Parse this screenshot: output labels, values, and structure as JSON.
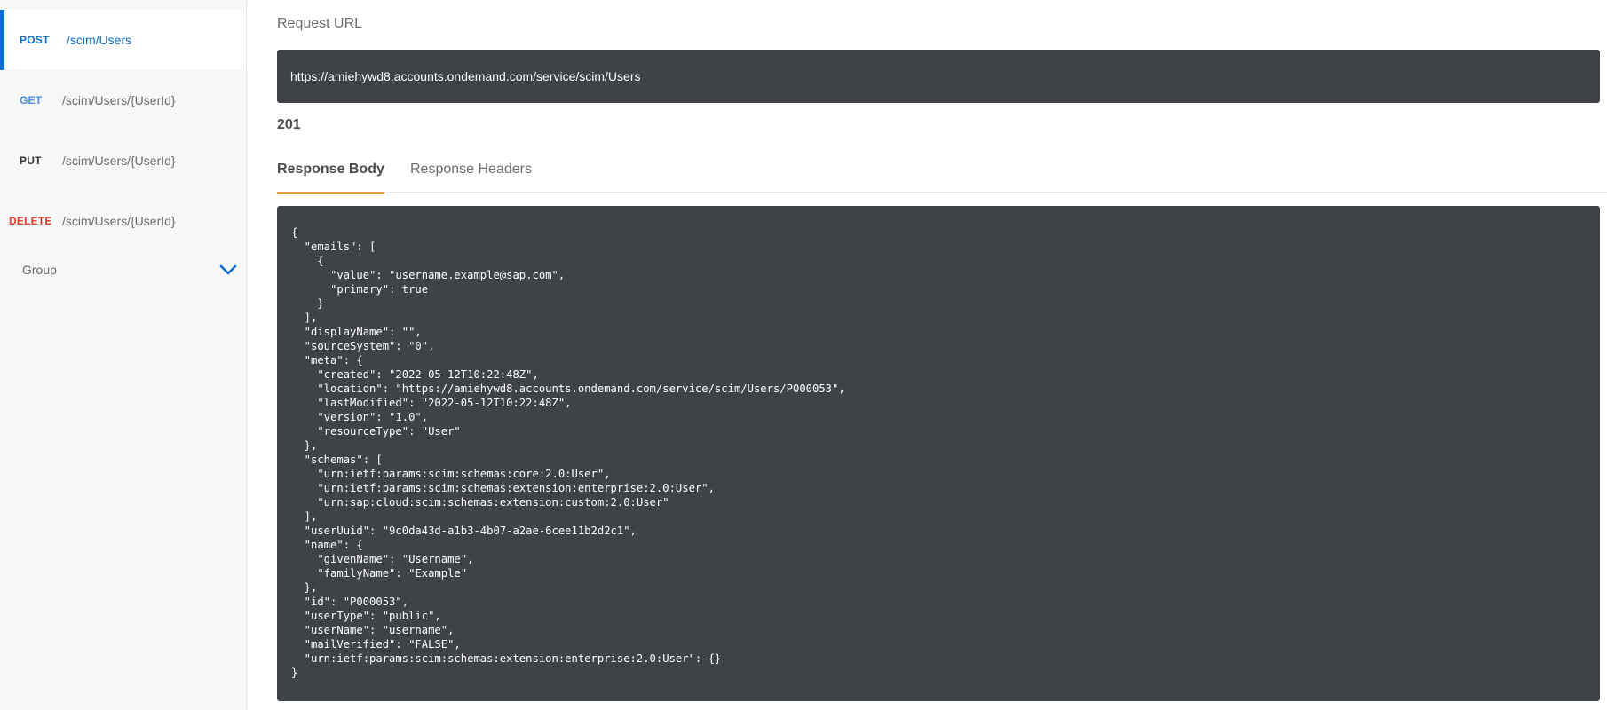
{
  "sidebar": {
    "items": [
      {
        "method": "POST",
        "path": "/scim/Users"
      },
      {
        "method": "GET",
        "path": "/scim/Users/{UserId}"
      },
      {
        "method": "PUT",
        "path": "/scim/Users/{UserId}"
      },
      {
        "method": "DELETE",
        "path": "/scim/Users/{UserId}"
      }
    ],
    "group": {
      "label": "Group",
      "icon": "chevron-down-icon"
    }
  },
  "request": {
    "label": "Request URL",
    "url": "https://amiehywd8.accounts.ondemand.com/service/scim/Users"
  },
  "status_code": "201",
  "tabs": [
    {
      "label": "Response Body",
      "active": true
    },
    {
      "label": "Response Headers",
      "active": false
    }
  ],
  "response_body": "{\n  \"emails\": [\n    {\n      \"value\": \"username.example@sap.com\",\n      \"primary\": true\n    }\n  ],\n  \"displayName\": \"\",\n  \"sourceSystem\": \"0\",\n  \"meta\": {\n    \"created\": \"2022-05-12T10:22:48Z\",\n    \"location\": \"https://amiehywd8.accounts.ondemand.com/service/scim/Users/P000053\",\n    \"lastModified\": \"2022-05-12T10:22:48Z\",\n    \"version\": \"1.0\",\n    \"resourceType\": \"User\"\n  },\n  \"schemas\": [\n    \"urn:ietf:params:scim:schemas:core:2.0:User\",\n    \"urn:ietf:params:scim:schemas:extension:enterprise:2.0:User\",\n    \"urn:sap:cloud:scim:schemas:extension:custom:2.0:User\"\n  ],\n  \"userUuid\": \"9c0da43d-a1b3-4b07-a2ae-6cee11b2d2c1\",\n  \"name\": {\n    \"givenName\": \"Username\",\n    \"familyName\": \"Example\"\n  },\n  \"id\": \"P000053\",\n  \"userType\": \"public\",\n  \"userName\": \"username\",\n  \"mailVerified\": \"FALSE\",\n  \"urn:ietf:params:scim:schemas:extension:enterprise:2.0:User\": {}\n}",
  "colors": {
    "accent": "#0a6ed1",
    "delete": "#e9372e",
    "tab_underline": "#e9a63c",
    "code_bg": "#3f4246"
  }
}
